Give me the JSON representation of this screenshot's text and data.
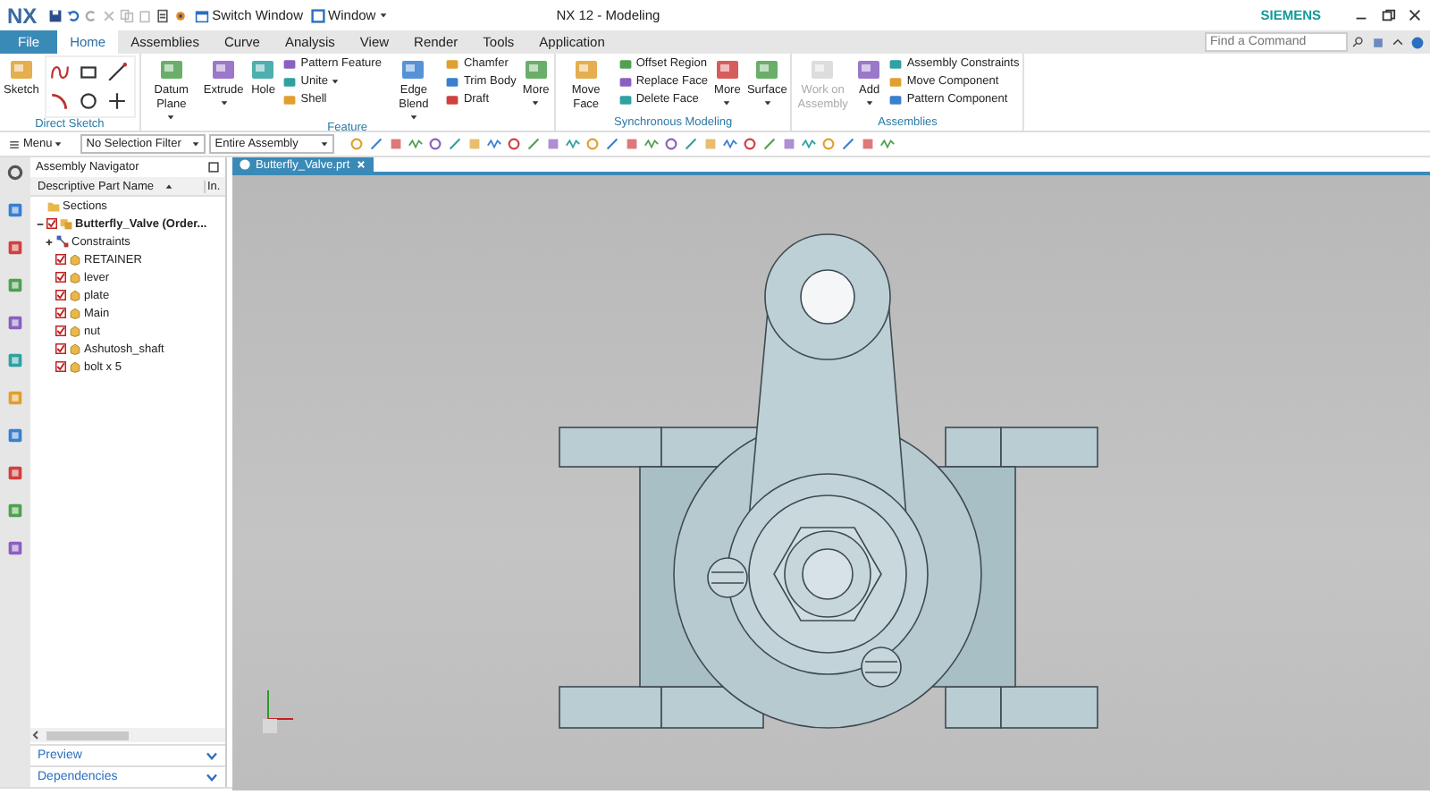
{
  "window": {
    "logo": "NX",
    "title": "NX 12 - Modeling",
    "brand": "SIEMENS"
  },
  "quick_access": {
    "switch_window": "Switch Window",
    "window_menu": "Window"
  },
  "tabs": [
    {
      "label": "File",
      "kind": "file",
      "selected": false
    },
    {
      "label": "Home",
      "kind": "tab",
      "selected": true
    },
    {
      "label": "Assemblies",
      "kind": "tab",
      "selected": false
    },
    {
      "label": "Curve",
      "kind": "tab",
      "selected": false
    },
    {
      "label": "Analysis",
      "kind": "tab",
      "selected": false
    },
    {
      "label": "View",
      "kind": "tab",
      "selected": false
    },
    {
      "label": "Render",
      "kind": "tab",
      "selected": false
    },
    {
      "label": "Tools",
      "kind": "tab",
      "selected": false
    },
    {
      "label": "Application",
      "kind": "tab",
      "selected": false
    }
  ],
  "command_search": {
    "placeholder": "Find a Command"
  },
  "ribbon": [
    {
      "title": "Direct Sketch",
      "items": [
        {
          "kind": "large",
          "label": "Sketch",
          "dropdown": false,
          "disabled": false
        },
        {
          "kind": "sketch_grid"
        }
      ]
    },
    {
      "title": "Feature",
      "items": [
        {
          "kind": "large",
          "label": "Datum Plane",
          "dropdown": true,
          "disabled": false
        },
        {
          "kind": "large",
          "label": "Extrude",
          "dropdown": true,
          "disabled": false
        },
        {
          "kind": "large",
          "label": "Hole",
          "dropdown": false,
          "disabled": false
        },
        {
          "kind": "stack",
          "entries": [
            {
              "label": "Pattern Feature",
              "dropdown": false
            },
            {
              "label": "Unite",
              "dropdown": true
            },
            {
              "label": "Shell",
              "dropdown": false
            }
          ]
        },
        {
          "kind": "large",
          "label": "Edge Blend",
          "dropdown": true,
          "disabled": false
        },
        {
          "kind": "stack",
          "entries": [
            {
              "label": "Chamfer",
              "dropdown": false
            },
            {
              "label": "Trim Body",
              "dropdown": false
            },
            {
              "label": "Draft",
              "dropdown": false
            }
          ]
        },
        {
          "kind": "large",
          "label": "More",
          "dropdown": true,
          "disabled": false
        }
      ]
    },
    {
      "title": "Synchronous Modeling",
      "items": [
        {
          "kind": "large",
          "label": "Move Face",
          "dropdown": false,
          "disabled": false
        },
        {
          "kind": "stack",
          "entries": [
            {
              "label": "Offset Region",
              "dropdown": false
            },
            {
              "label": "Replace Face",
              "dropdown": false
            },
            {
              "label": "Delete Face",
              "dropdown": false
            }
          ]
        },
        {
          "kind": "large",
          "label": "More",
          "dropdown": true,
          "disabled": false
        },
        {
          "kind": "large",
          "label": "Surface",
          "dropdown": true,
          "disabled": false
        }
      ]
    },
    {
      "title": "Assemblies",
      "items": [
        {
          "kind": "large",
          "label": "Work on Assembly",
          "dropdown": false,
          "disabled": true
        },
        {
          "kind": "large",
          "label": "Add",
          "dropdown": true,
          "disabled": false
        },
        {
          "kind": "stack",
          "entries": [
            {
              "label": "Assembly Constraints",
              "dropdown": false
            },
            {
              "label": "Move Component",
              "dropdown": false
            },
            {
              "label": "Pattern Component",
              "dropdown": false
            }
          ]
        }
      ]
    }
  ],
  "toolbar": {
    "menu": "Menu",
    "selection_filter": "No Selection Filter",
    "scope": "Entire Assembly"
  },
  "navigator": {
    "title": "Assembly Navigator",
    "columns": [
      "Descriptive Part Name",
      "In."
    ],
    "tree": [
      {
        "label": "Sections",
        "kind": "folder"
      },
      {
        "label": "Butterfly_Valve (Order...",
        "kind": "assembly",
        "expanded": true,
        "checked": true,
        "children": [
          {
            "label": "Constraints",
            "kind": "constraints",
            "expanded": false
          },
          {
            "label": "RETAINER",
            "kind": "part",
            "checked": true
          },
          {
            "label": "lever",
            "kind": "part",
            "checked": true
          },
          {
            "label": "plate",
            "kind": "part",
            "checked": true
          },
          {
            "label": "Main",
            "kind": "part",
            "checked": true
          },
          {
            "label": "nut",
            "kind": "part",
            "checked": true
          },
          {
            "label": "Ashutosh_shaft",
            "kind": "part",
            "checked": true
          },
          {
            "label": "bolt x 5",
            "kind": "part",
            "checked": true
          }
        ]
      }
    ],
    "sections": [
      {
        "label": "Preview",
        "expanded": false
      },
      {
        "label": "Dependencies",
        "expanded": false
      }
    ]
  },
  "doc_tabs": [
    {
      "label": "Butterfly_Valve.prt",
      "selected": true
    }
  ]
}
